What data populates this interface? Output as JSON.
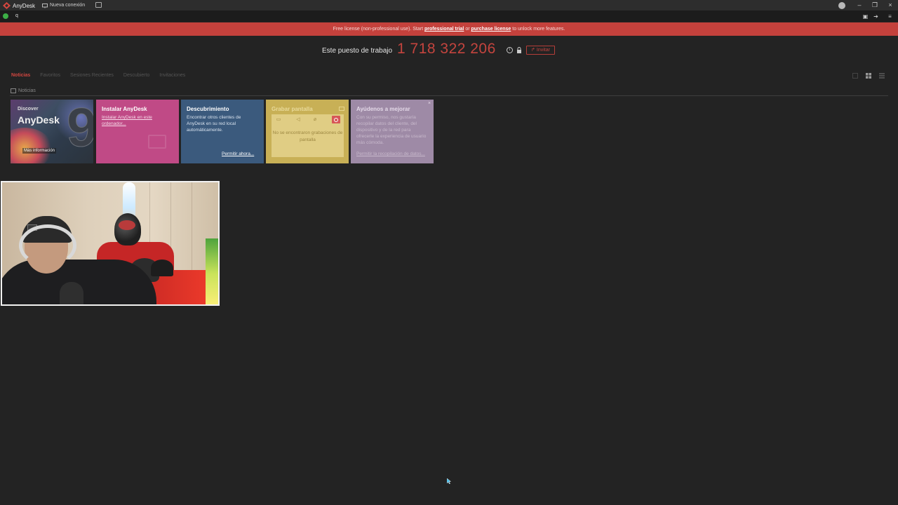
{
  "titlebar": {
    "app_tab": "AnyDesk",
    "new_connection_tab": "Nueva conexión"
  },
  "addressbar": {
    "value": "q"
  },
  "banner": {
    "prefix": "Free license (non-professional use). Start ",
    "trial_link": "professional trial",
    "middle": " or ",
    "purchase_link": "purchase license",
    "suffix": " to unlock more features."
  },
  "workplace": {
    "label": "Este puesto de trabajo",
    "id": "1 718 322 206",
    "invite": "Invitar"
  },
  "tabs": {
    "news": "Noticias",
    "favorites": "Favoritos",
    "recent": "Sesiones Recientes",
    "discovery": "Descubierto",
    "invitations": "Invitaciones"
  },
  "section": {
    "label": "Noticias"
  },
  "cards": {
    "discover": {
      "small": "Discover",
      "big": "AnyDesk",
      "number": "9",
      "more": "Más información"
    },
    "install": {
      "title": "Instalar AnyDesk",
      "link": "Instalar AnyDesk en este ordenador..."
    },
    "discovery": {
      "title": "Descubrimiento",
      "text": "Encontrar otros clientes de AnyDesk en su red local automáticamente.",
      "link": "Permitir ahora..."
    },
    "record": {
      "title": "Grabar pantalla",
      "empty": "No se encontraron grabaciones de pantalla"
    },
    "help": {
      "title": "Ayúdenos a mejorar",
      "text": "Con su permiso, nos gustaría recopilar datos del cliente, del dispositivo y de la red para ofrecerle la experiencia de usuario más cómoda.",
      "link": "Permitir la recopilación de datos..."
    }
  },
  "colors": {
    "accent": "#c4443e",
    "background": "#232323",
    "install_card": "#c04a86",
    "discovery_card": "#3b5a7d",
    "record_card": "#c8b056",
    "help_card": "#9e8aa6"
  },
  "icons": {
    "app": "anydesk-logo-icon",
    "monitor": "monitor-icon",
    "status": "connected-status-icon",
    "info": "info-icon",
    "lock": "lock-icon",
    "share": "share-icon",
    "download": "download-icon",
    "menu": "hamburger-menu-icon"
  }
}
